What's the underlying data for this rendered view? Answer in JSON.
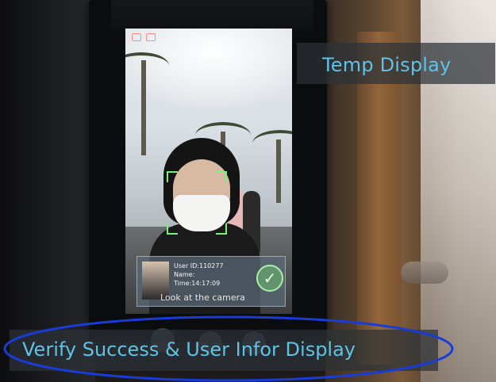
{
  "captions": {
    "temp": "Temp Display",
    "verify": "Verify Success & User Infor Display"
  },
  "screen": {
    "user_id_label": "User ID:110277",
    "name_label": "Name:",
    "time_label": "Time:14:17:09",
    "prompt": "Look at the camera"
  },
  "colors": {
    "caption_text": "#5ec3e6",
    "highlight_ellipse": "#1a3cd6",
    "face_bracket": "#7cf07c"
  },
  "icons": [
    "check-icon",
    "status-icon"
  ]
}
